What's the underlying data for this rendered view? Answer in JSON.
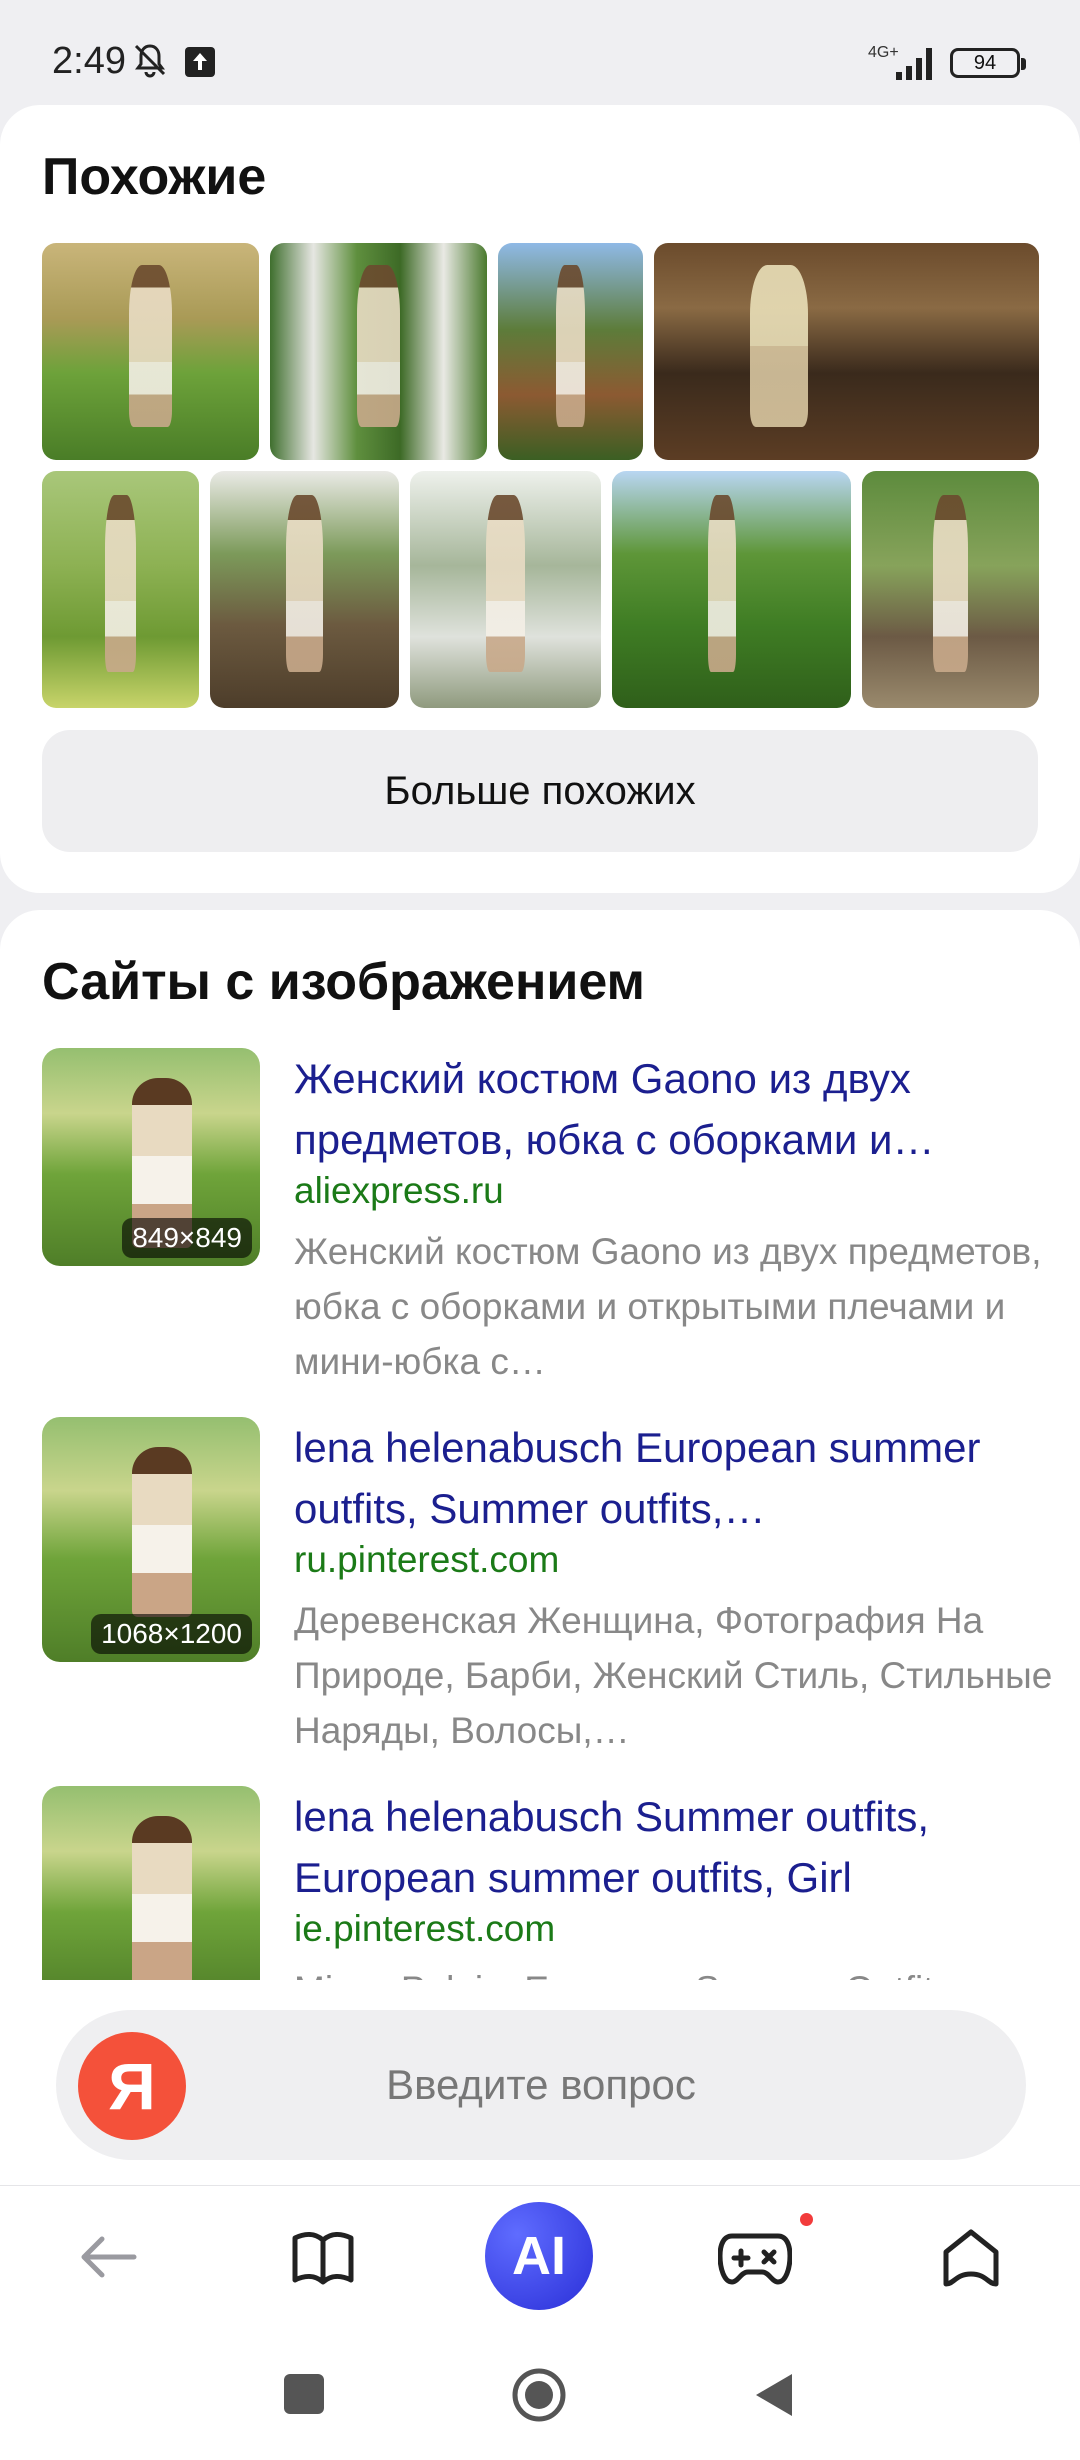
{
  "status_bar": {
    "time": "2:49",
    "network": "4G+",
    "battery": "94"
  },
  "similar": {
    "title": "Похожие",
    "more_button": "Больше похожих"
  },
  "sites": {
    "title": "Сайты с изображением",
    "results": [
      {
        "title": "Женский костюм Gaono из двух предметов, юбка с оборками и…",
        "domain": "aliexpress.ru",
        "snippet": "Женский костюм Gaono из двух предметов, юбка с оборками и открытыми плечами и мини-юбка с…",
        "size": "849×849"
      },
      {
        "title": "lena helenabusch European summer outfits, Summer outfits,…",
        "domain": "ru.pinterest.com",
        "snippet": "Деревенская Женщина, Фотография На Природе, Барби, Женский Стиль, Стильные Наряды, Волосы,…",
        "size": "1068×1200"
      },
      {
        "title": "lena helenabusch Summer outfits, European summer outfits, Girl",
        "domain": "ie.pinterest.com",
        "snippet": "Mirror Pelaie, European Summer Outfits…",
        "size": ""
      }
    ]
  },
  "search": {
    "logo": "Я",
    "placeholder": "Введите вопрос"
  },
  "bottom_nav": {
    "ai_label": "AI"
  },
  "colors": {
    "link": "#1b1f8f",
    "domain": "#1b7a17",
    "yandex_red": "#f4513a",
    "ai_blue": "#2a2fd8"
  }
}
